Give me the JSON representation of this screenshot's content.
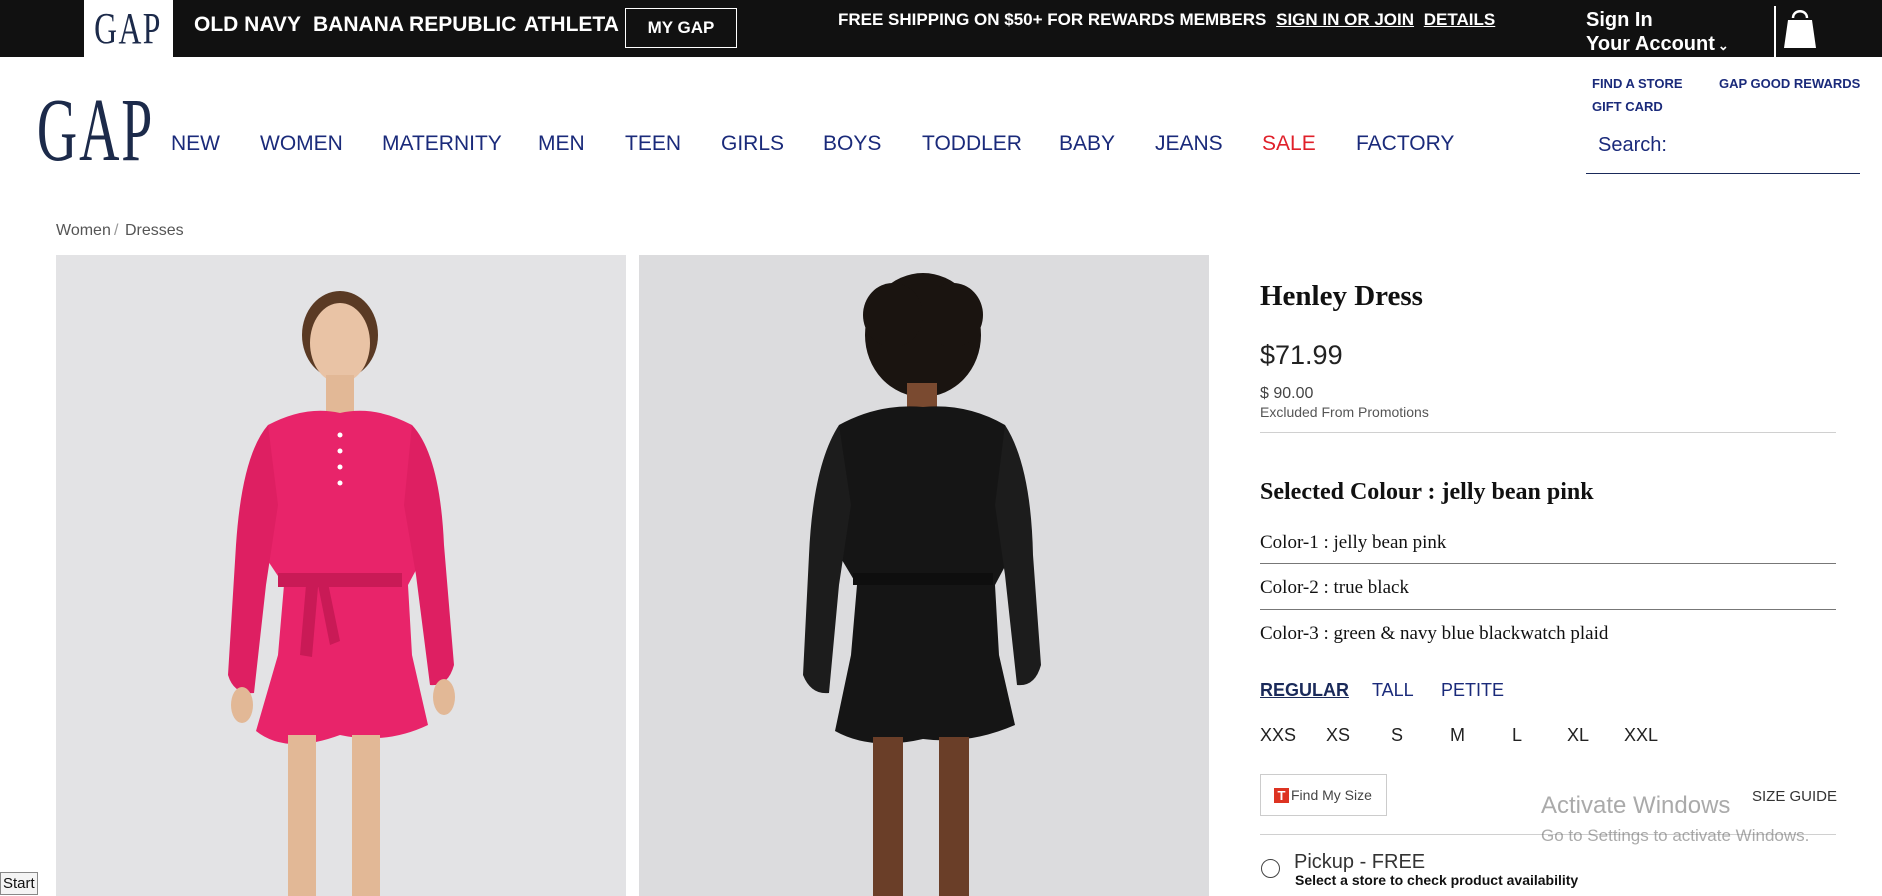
{
  "topbar": {
    "logo": "GAP",
    "brands": [
      "OLD NAVY",
      "BANANA REPUBLIC",
      "ATHLETA"
    ],
    "my_gap": "MY GAP",
    "promo_text": "FREE SHIPPING ON $50+ FOR REWARDS MEMBERS",
    "sign_in_link": "SIGN IN OR JOIN",
    "details_link": "DETAILS",
    "sign_in": "Sign In",
    "your_account": "Your Account",
    "bag_icon": "shopping-bag-icon"
  },
  "header": {
    "logo": "GAP",
    "nav": [
      "NEW",
      "WOMEN",
      "MATERNITY",
      "MEN",
      "TEEN",
      "GIRLS",
      "BOYS",
      "TODDLER",
      "BABY",
      "JEANS",
      "SALE",
      "FACTORY"
    ],
    "sale_color": "#e0202a",
    "nav_color": "#1a2a7a",
    "util": {
      "find_store": "FIND A STORE",
      "rewards": "GAP GOOD REWARDS",
      "gift_card": "GIFT CARD"
    },
    "search_label": "Search:"
  },
  "breadcrumb": {
    "items": [
      "Women",
      "Dresses"
    ],
    "separator": "/"
  },
  "product": {
    "title": "Henley Dress",
    "price": "$71.99",
    "original_price": "$ 90.00",
    "promo_note": "Excluded From Promotions",
    "selected_colour": "Selected Colour : jelly bean pink",
    "colors": [
      "Color-1 : jelly bean pink",
      "Color-2 : true black",
      "Color-3 : green & navy blue blackwatch plaid"
    ],
    "fits": [
      "REGULAR",
      "TALL",
      "PETITE"
    ],
    "sizes": [
      "XXS",
      "XS",
      "S",
      "M",
      "L",
      "XL",
      "XXL"
    ],
    "find_my_size": "Find My Size",
    "size_guide": "SIZE GUIDE",
    "pickup": "Pickup - FREE",
    "pickup_note": "Select a store to check product availability",
    "dress_color_front": "#e8246a",
    "dress_color_back": "#141414"
  },
  "overlay": {
    "activate_title": "Activate Windows",
    "activate_sub": "Go to Settings to activate Windows.",
    "start": "Start"
  }
}
